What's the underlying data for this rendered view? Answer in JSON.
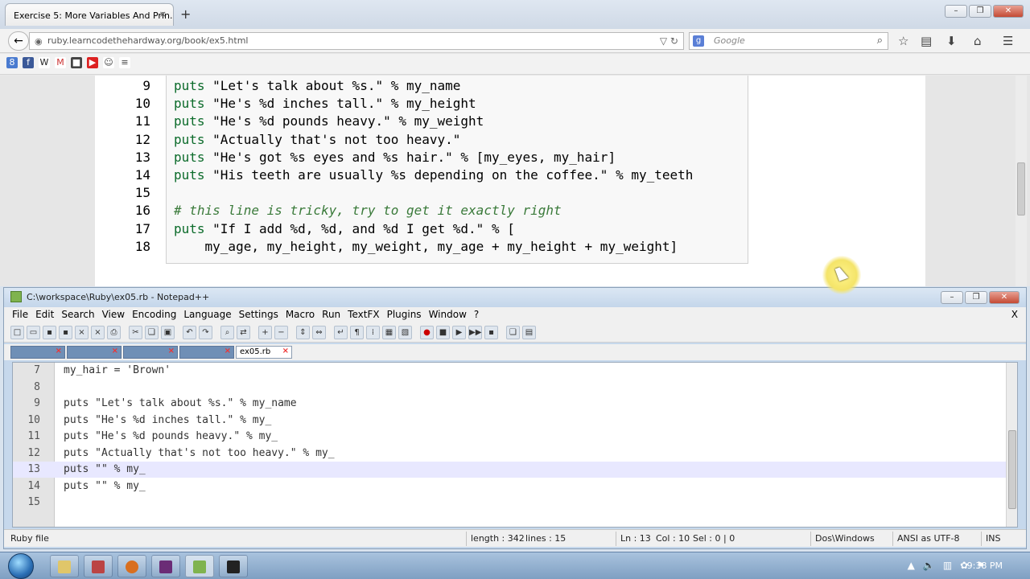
{
  "browser": {
    "tab_title": "Exercise 5: More Variables And Prin...",
    "tab_close": "×",
    "new_tab": "+",
    "url": "ruby.learncodethehardway.org/book/ex5.html",
    "search_placeholder": "Google",
    "code_lines": [
      {
        "num": "9",
        "code": "puts \"Let's talk about %s.\" % my_name"
      },
      {
        "num": "10",
        "code": "puts \"He's %d inches tall.\" % my_height"
      },
      {
        "num": "11",
        "code": "puts \"He's %d pounds heavy.\" % my_weight"
      },
      {
        "num": "12",
        "code": "puts \"Actually that's not too heavy.\""
      },
      {
        "num": "13",
        "code": "puts \"He's got %s eyes and %s hair.\" % [my_eyes, my_hair]"
      },
      {
        "num": "14",
        "code": "puts \"His teeth are usually %s depending on the coffee.\" % my_teeth"
      },
      {
        "num": "15",
        "code": ""
      },
      {
        "num": "16",
        "code": "# this line is tricky, try to get it exactly right"
      },
      {
        "num": "17",
        "code": "puts \"If I add %d, %d, and %d I get %d.\" % ["
      },
      {
        "num": "18",
        "code": "    my_age, my_height, my_weight, my_age + my_height + my_weight]"
      }
    ]
  },
  "npp": {
    "title": "C:\\workspace\\Ruby\\ex05.rb - Notepad++",
    "menu": [
      "File",
      "Edit",
      "Search",
      "View",
      "Encoding",
      "Language",
      "Settings",
      "Macro",
      "Run",
      "TextFX",
      "Plugins",
      "Window",
      "?"
    ],
    "menu_close": "X",
    "active_tab": "ex05.rb",
    "tab_close": "×",
    "lines": [
      {
        "num": "7",
        "text": "my_hair = 'Brown'"
      },
      {
        "num": "8",
        "text": ""
      },
      {
        "num": "9",
        "text": "puts \"Let's talk about %s.\" % my_name"
      },
      {
        "num": "10",
        "text": "puts \"He's %d inches tall.\" % my_"
      },
      {
        "num": "11",
        "text": "puts \"He's %d pounds heavy.\" % my_"
      },
      {
        "num": "12",
        "text": "puts \"Actually that's not too heavy.\" % my_"
      },
      {
        "num": "13",
        "text": "puts \"\" % my_"
      },
      {
        "num": "14",
        "text": "puts \"\" % my_"
      },
      {
        "num": "15",
        "text": ""
      }
    ],
    "status": {
      "type": "Ruby file",
      "length": "length : 342",
      "lines": "lines : 15",
      "ln": "Ln : 13",
      "col": "Col : 10",
      "sel": "Sel : 0 | 0",
      "eol": "Dos\\Windows",
      "encoding": "ANSI as UTF-8",
      "mode": "INS"
    }
  },
  "taskbar": {
    "clock": "9:38 PM"
  },
  "colors": {
    "keyword": "#0b6b2a",
    "comment": "#3a7a3a",
    "npp_tab": "#6f8fb6",
    "current_line": "#e8e8ff"
  }
}
